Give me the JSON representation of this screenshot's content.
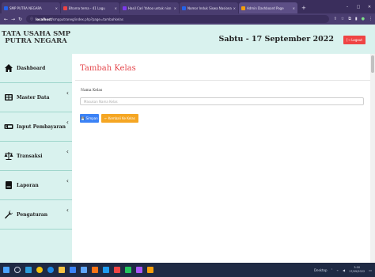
{
  "browser": {
    "tabs": [
      {
        "label": "SMP PUTRA NEGARA",
        "color": "#2563eb",
        "active": false
      },
      {
        "label": "Bhama tema - 41 Lagu",
        "color": "#ef4444",
        "active": false
      },
      {
        "label": "Hasil Cari Yahoo untuk nisn",
        "color": "#7c3aed",
        "active": false
      },
      {
        "label": "Nomor Induk Siswa Nasional",
        "color": "#2563eb",
        "active": false
      },
      {
        "label": "Admin Dashboard Page",
        "color": "#f59e0b",
        "active": true
      }
    ],
    "url_host": "localhost",
    "url_path": "/smpputraneg/index.php?page=tambahkelas"
  },
  "app": {
    "brand": "TATA USAHA SMP PUTRA NEGARA",
    "date": "Sabtu - 17 September 2022",
    "logout_label": "[→ Logout",
    "colors": {
      "accent": "#e5484d",
      "panel": "#d9f2ee",
      "save": "#3b82f6",
      "back": "#f5a623",
      "logout": "#ef4444"
    }
  },
  "sidebar": {
    "items": [
      {
        "label": "Dashboard",
        "icon": "home-icon",
        "has_submenu": false
      },
      {
        "label": "Master Data",
        "icon": "grid-icon",
        "has_submenu": true
      },
      {
        "label": "Input Pembayaran",
        "icon": "money-icon",
        "has_submenu": true
      },
      {
        "label": "Transaksi",
        "icon": "scale-icon",
        "has_submenu": true
      },
      {
        "label": "Laporan",
        "icon": "document-icon",
        "has_submenu": true
      },
      {
        "label": "Pengaturan",
        "icon": "wrench-icon",
        "has_submenu": true
      }
    ]
  },
  "main": {
    "title": "Tambah Kelas",
    "field_label": "Nama Kelas",
    "field_placeholder": "Masukan Nama Kelas",
    "field_value": "",
    "save_label": "💾 Simpan",
    "back_label": "← Kembali Ke Kelas"
  },
  "taskbar": {
    "language": "Desktop",
    "time": "3:00",
    "date": "17/09/2022"
  }
}
